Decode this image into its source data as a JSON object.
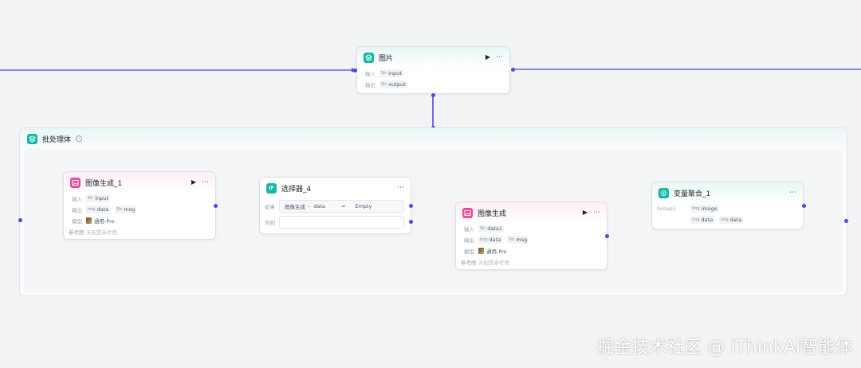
{
  "colors": {
    "wire": "#4f46e5",
    "teal": "#14b8a6",
    "pink": "#ec4899",
    "canvas": "#f2f3f5"
  },
  "image_node": {
    "title": "图片",
    "input_label": "输入",
    "input_type": "Str",
    "input_value": "input",
    "output_label": "输出",
    "output_type": "Str",
    "output_value": "output"
  },
  "batch": {
    "title": "批处理体"
  },
  "gen1": {
    "title": "图像生成_1",
    "input_label": "输入",
    "input_type": "Str",
    "input_value": "input",
    "output_label": "输出",
    "output_type_1": "Img",
    "output_value_1": "data",
    "output_type_2": "Str",
    "output_value_2": "msg",
    "model_label": "模型",
    "model_value": "通用-Pro",
    "ref_label": "参考图",
    "ref_value": "未配置参考图"
  },
  "selector": {
    "title": "选择器_4",
    "if_label": "如果",
    "cond_left": "图像生成",
    "cond_sep": "-",
    "cond_var": "data",
    "cond_op": "=",
    "cond_right": "Empty",
    "else_label": "否则"
  },
  "gen2": {
    "title": "图像生成",
    "input_label": "输入",
    "input_type": "Str",
    "input_value": "data1",
    "output_label": "输出",
    "output_type_1": "Img",
    "output_value_1": "data",
    "output_type_2": "Str",
    "output_value_2": "msg",
    "model_label": "模型",
    "model_value": "通用-Pro",
    "ref_label": "参考图",
    "ref_value": "未配置参考图"
  },
  "aggregate": {
    "title": "变量聚合_1",
    "group_label": "Group1",
    "group_type": "Img",
    "group_value": "image",
    "item_value_1": "data",
    "item_value_2": "data"
  },
  "watermark": "掘金技术社区 @ iThinkAi智能体"
}
